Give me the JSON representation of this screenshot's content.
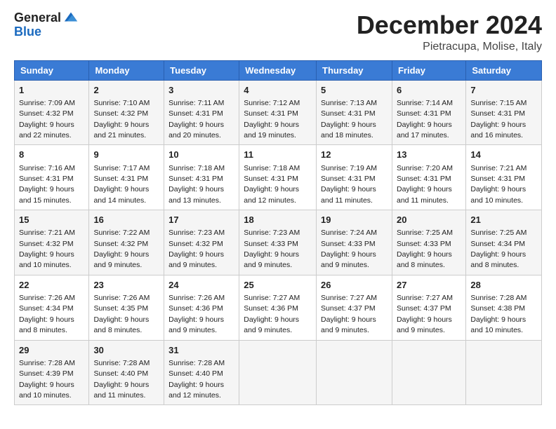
{
  "logo": {
    "general": "General",
    "blue": "Blue"
  },
  "header": {
    "month": "December 2024",
    "location": "Pietracupa, Molise, Italy"
  },
  "weekdays": [
    "Sunday",
    "Monday",
    "Tuesday",
    "Wednesday",
    "Thursday",
    "Friday",
    "Saturday"
  ],
  "weeks": [
    [
      {
        "day": "1",
        "sunrise": "Sunrise: 7:09 AM",
        "sunset": "Sunset: 4:32 PM",
        "daylight": "Daylight: 9 hours and 22 minutes."
      },
      {
        "day": "2",
        "sunrise": "Sunrise: 7:10 AM",
        "sunset": "Sunset: 4:32 PM",
        "daylight": "Daylight: 9 hours and 21 minutes."
      },
      {
        "day": "3",
        "sunrise": "Sunrise: 7:11 AM",
        "sunset": "Sunset: 4:31 PM",
        "daylight": "Daylight: 9 hours and 20 minutes."
      },
      {
        "day": "4",
        "sunrise": "Sunrise: 7:12 AM",
        "sunset": "Sunset: 4:31 PM",
        "daylight": "Daylight: 9 hours and 19 minutes."
      },
      {
        "day": "5",
        "sunrise": "Sunrise: 7:13 AM",
        "sunset": "Sunset: 4:31 PM",
        "daylight": "Daylight: 9 hours and 18 minutes."
      },
      {
        "day": "6",
        "sunrise": "Sunrise: 7:14 AM",
        "sunset": "Sunset: 4:31 PM",
        "daylight": "Daylight: 9 hours and 17 minutes."
      },
      {
        "day": "7",
        "sunrise": "Sunrise: 7:15 AM",
        "sunset": "Sunset: 4:31 PM",
        "daylight": "Daylight: 9 hours and 16 minutes."
      }
    ],
    [
      {
        "day": "8",
        "sunrise": "Sunrise: 7:16 AM",
        "sunset": "Sunset: 4:31 PM",
        "daylight": "Daylight: 9 hours and 15 minutes."
      },
      {
        "day": "9",
        "sunrise": "Sunrise: 7:17 AM",
        "sunset": "Sunset: 4:31 PM",
        "daylight": "Daylight: 9 hours and 14 minutes."
      },
      {
        "day": "10",
        "sunrise": "Sunrise: 7:18 AM",
        "sunset": "Sunset: 4:31 PM",
        "daylight": "Daylight: 9 hours and 13 minutes."
      },
      {
        "day": "11",
        "sunrise": "Sunrise: 7:18 AM",
        "sunset": "Sunset: 4:31 PM",
        "daylight": "Daylight: 9 hours and 12 minutes."
      },
      {
        "day": "12",
        "sunrise": "Sunrise: 7:19 AM",
        "sunset": "Sunset: 4:31 PM",
        "daylight": "Daylight: 9 hours and 11 minutes."
      },
      {
        "day": "13",
        "sunrise": "Sunrise: 7:20 AM",
        "sunset": "Sunset: 4:31 PM",
        "daylight": "Daylight: 9 hours and 11 minutes."
      },
      {
        "day": "14",
        "sunrise": "Sunrise: 7:21 AM",
        "sunset": "Sunset: 4:31 PM",
        "daylight": "Daylight: 9 hours and 10 minutes."
      }
    ],
    [
      {
        "day": "15",
        "sunrise": "Sunrise: 7:21 AM",
        "sunset": "Sunset: 4:32 PM",
        "daylight": "Daylight: 9 hours and 10 minutes."
      },
      {
        "day": "16",
        "sunrise": "Sunrise: 7:22 AM",
        "sunset": "Sunset: 4:32 PM",
        "daylight": "Daylight: 9 hours and 9 minutes."
      },
      {
        "day": "17",
        "sunrise": "Sunrise: 7:23 AM",
        "sunset": "Sunset: 4:32 PM",
        "daylight": "Daylight: 9 hours and 9 minutes."
      },
      {
        "day": "18",
        "sunrise": "Sunrise: 7:23 AM",
        "sunset": "Sunset: 4:33 PM",
        "daylight": "Daylight: 9 hours and 9 minutes."
      },
      {
        "day": "19",
        "sunrise": "Sunrise: 7:24 AM",
        "sunset": "Sunset: 4:33 PM",
        "daylight": "Daylight: 9 hours and 9 minutes."
      },
      {
        "day": "20",
        "sunrise": "Sunrise: 7:25 AM",
        "sunset": "Sunset: 4:33 PM",
        "daylight": "Daylight: 9 hours and 8 minutes."
      },
      {
        "day": "21",
        "sunrise": "Sunrise: 7:25 AM",
        "sunset": "Sunset: 4:34 PM",
        "daylight": "Daylight: 9 hours and 8 minutes."
      }
    ],
    [
      {
        "day": "22",
        "sunrise": "Sunrise: 7:26 AM",
        "sunset": "Sunset: 4:34 PM",
        "daylight": "Daylight: 9 hours and 8 minutes."
      },
      {
        "day": "23",
        "sunrise": "Sunrise: 7:26 AM",
        "sunset": "Sunset: 4:35 PM",
        "daylight": "Daylight: 9 hours and 8 minutes."
      },
      {
        "day": "24",
        "sunrise": "Sunrise: 7:26 AM",
        "sunset": "Sunset: 4:36 PM",
        "daylight": "Daylight: 9 hours and 9 minutes."
      },
      {
        "day": "25",
        "sunrise": "Sunrise: 7:27 AM",
        "sunset": "Sunset: 4:36 PM",
        "daylight": "Daylight: 9 hours and 9 minutes."
      },
      {
        "day": "26",
        "sunrise": "Sunrise: 7:27 AM",
        "sunset": "Sunset: 4:37 PM",
        "daylight": "Daylight: 9 hours and 9 minutes."
      },
      {
        "day": "27",
        "sunrise": "Sunrise: 7:27 AM",
        "sunset": "Sunset: 4:37 PM",
        "daylight": "Daylight: 9 hours and 9 minutes."
      },
      {
        "day": "28",
        "sunrise": "Sunrise: 7:28 AM",
        "sunset": "Sunset: 4:38 PM",
        "daylight": "Daylight: 9 hours and 10 minutes."
      }
    ],
    [
      {
        "day": "29",
        "sunrise": "Sunrise: 7:28 AM",
        "sunset": "Sunset: 4:39 PM",
        "daylight": "Daylight: 9 hours and 10 minutes."
      },
      {
        "day": "30",
        "sunrise": "Sunrise: 7:28 AM",
        "sunset": "Sunset: 4:40 PM",
        "daylight": "Daylight: 9 hours and 11 minutes."
      },
      {
        "day": "31",
        "sunrise": "Sunrise: 7:28 AM",
        "sunset": "Sunset: 4:40 PM",
        "daylight": "Daylight: 9 hours and 12 minutes."
      },
      null,
      null,
      null,
      null
    ]
  ]
}
